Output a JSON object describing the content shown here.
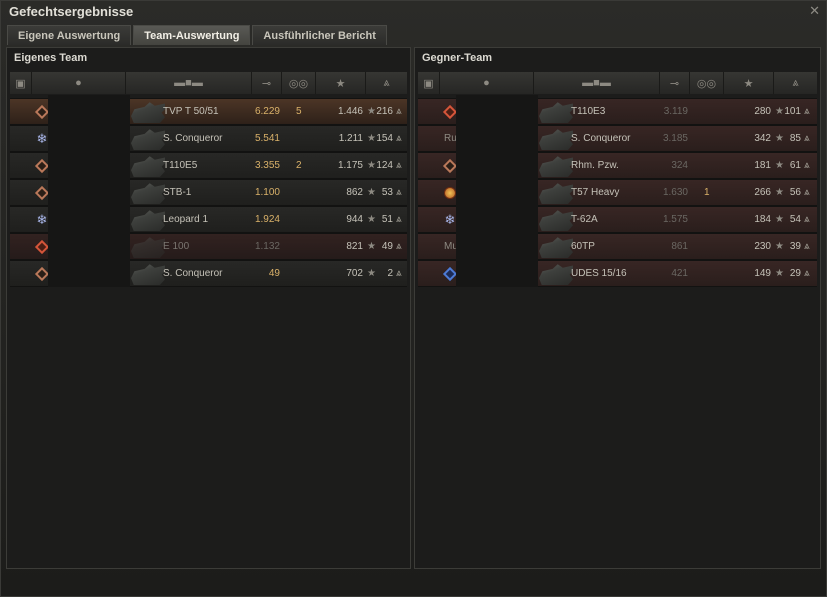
{
  "window": {
    "title": "Gefechtsergebnisse"
  },
  "tabs": [
    {
      "label": "Eigene Auswertung"
    },
    {
      "label": "Team-Auswertung"
    },
    {
      "label": "Ausführlicher Bericht"
    }
  ],
  "own": {
    "title": "Eigenes Team",
    "rows": [
      {
        "tank": "TVP T 50/51",
        "damage": "6.229",
        "kills": "5",
        "xp": "1.446",
        "score": "216",
        "icon": "diamond",
        "style": "hl"
      },
      {
        "tank": "S. Conqueror",
        "damage": "5.541",
        "kills": "",
        "xp": "1.211",
        "score": "154",
        "icon": "flake",
        "style": "alive"
      },
      {
        "tank": "T110E5",
        "damage": "3.355",
        "kills": "2",
        "xp": "1.175",
        "score": "124",
        "icon": "diamond",
        "style": "alive"
      },
      {
        "tank": "STB-1",
        "damage": "1.100",
        "kills": "",
        "xp": "862",
        "score": "53",
        "icon": "diamond",
        "style": "alive"
      },
      {
        "tank": "Leopard 1",
        "damage": "1.924",
        "kills": "",
        "xp": "944",
        "score": "51",
        "icon": "flake",
        "style": "alive"
      },
      {
        "tank": "E 100",
        "damage": "1.132",
        "kills": "",
        "xp": "821",
        "score": "49",
        "icon": "diamond-red",
        "style": "dead"
      },
      {
        "tank": "S. Conqueror",
        "damage": "49",
        "kills": "",
        "xp": "702",
        "score": "2",
        "icon": "diamond",
        "style": "alive"
      }
    ]
  },
  "enemy": {
    "title": "Gegner-Team",
    "rows": [
      {
        "prefix": "",
        "tank": "T110E3",
        "damage": "3.119",
        "kills": "",
        "xp": "280",
        "score": "101",
        "icon": "diamond-red"
      },
      {
        "prefix": "Rudi",
        "tank": "S. Conqueror",
        "damage": "3.185",
        "kills": "",
        "xp": "342",
        "score": "85",
        "icon": ""
      },
      {
        "prefix": "",
        "tank": "Rhm. Pzw.",
        "damage": "324",
        "kills": "",
        "xp": "181",
        "score": "61",
        "icon": "diamond"
      },
      {
        "prefix": "",
        "tank": "T57 Heavy",
        "damage": "1.630",
        "kills": "1",
        "xp": "266",
        "score": "56",
        "icon": "medal"
      },
      {
        "prefix": "",
        "tank": "T-62A",
        "damage": "1.575",
        "kills": "",
        "xp": "184",
        "score": "54",
        "icon": "flake"
      },
      {
        "prefix": "Mulli",
        "tank": "60TP",
        "damage": "861",
        "kills": "",
        "xp": "230",
        "score": "39",
        "icon": ""
      },
      {
        "prefix": "",
        "tank": "UDES 15/16",
        "damage": "421",
        "kills": "",
        "xp": "149",
        "score": "29",
        "icon": "diamond-blue"
      }
    ]
  },
  "icons": {
    "close": "close-icon",
    "platoon": "platoon-icon",
    "player": "player-icon",
    "vehicle": "vehicle-icon",
    "damage": "damage-icon",
    "kills": "kills-icon",
    "xp": "xp-icon",
    "score": "rank-icon",
    "star": "star-icon",
    "medal": "medal-icon"
  },
  "colors": {
    "highlight": "#4c3526",
    "gold": "#d9b169",
    "dead": "#322220"
  }
}
